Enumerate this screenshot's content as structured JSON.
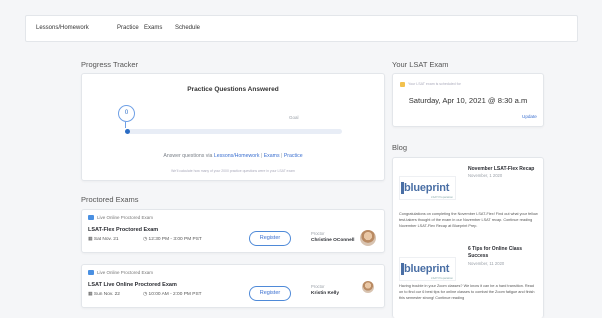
{
  "nav": {
    "tabs": [
      "Lessons/Homework",
      "Practice",
      "Exams",
      "Schedule"
    ]
  },
  "progress": {
    "section_title": "Progress Tracker",
    "card_title": "Practice Questions Answered",
    "current_value": "0",
    "goal_label": "Goal",
    "answer_prompt": "Answer questions via",
    "links": [
      "Lessons/Homework",
      "Exams",
      "Practice"
    ],
    "separator": "|",
    "footnote": "We'll calculate how many of your 2000 practice questions were in your LSAT exam",
    "fraction_complete": 0
  },
  "proctored": {
    "section_title": "Proctored Exams",
    "exams": [
      {
        "tag": "Live Online Proctored Exam",
        "title": "LSAT-Flex Proctored Exam",
        "date": "Sat Nov. 21",
        "time": "12:30 PM - 3:00 PM PST",
        "register_label": "Register",
        "proctor_label": "Proctor",
        "proctor_name": "Christine OConnell"
      },
      {
        "tag": "Live Online Proctored Exam",
        "title": "LSAT Live Online Proctored Exam",
        "date": "Sun Nov. 22",
        "time": "10:00 AM - 2:00 PM PST",
        "register_label": "Register",
        "proctor_label": "Proctor",
        "proctor_name": "Kristin Kelly"
      }
    ]
  },
  "lsat_exam": {
    "section_title": "Your LSAT Exam",
    "small_label": "Your LSAT exam is scheduled for",
    "date": "Saturday, Apr 10, 2021 @ 8:30 a.m",
    "update_label": "Update"
  },
  "blog": {
    "section_title": "Blog",
    "logo_word": "blueprint",
    "logo_sub": "LSAT Preparation",
    "posts": [
      {
        "title": "November LSAT-Flex Recap",
        "date": "November, 1 2020",
        "excerpt": "Congratulations on completing the November LSAT-Flex! Find out what your fellow test-takers thought of the exam in our November LSAT recap. Continue reading November LSAT-Flex Recap at Blueprint Prep."
      },
      {
        "title": "6 Tips for Online Class Success",
        "date": "November, 11 2020",
        "excerpt": "Having trouble in your Zoom classes? We know it can be a hard transition. Read on to find our 6 best tips for online classes to combat the Zoom fatigue and finish this semester strong! Continue reading"
      }
    ]
  },
  "colors": {
    "accent": "#3a6fd0",
    "progress_fill": "#2a6cc4",
    "track": "#e8edf6"
  }
}
